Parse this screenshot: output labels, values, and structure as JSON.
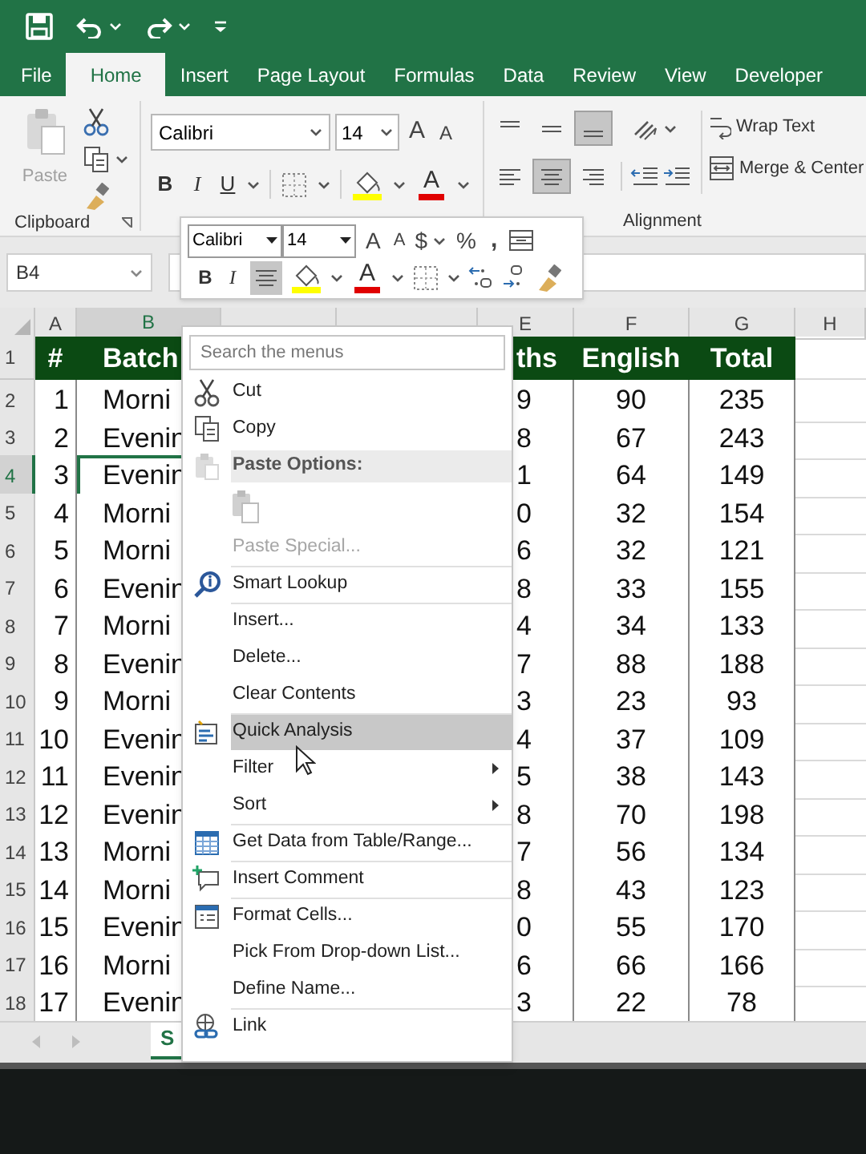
{
  "tabs": [
    {
      "label": "File",
      "selected": false
    },
    {
      "label": "Home",
      "selected": true
    },
    {
      "label": "Insert",
      "selected": false
    },
    {
      "label": "Page Layout",
      "selected": false
    },
    {
      "label": "Formulas",
      "selected": false
    },
    {
      "label": "Data",
      "selected": false
    },
    {
      "label": "Review",
      "selected": false
    },
    {
      "label": "View",
      "selected": false
    },
    {
      "label": "Developer",
      "selected": false
    }
  ],
  "ribbon": {
    "paste_label": "Paste",
    "paste_disabled": true,
    "font_name": "Calibri",
    "font_size": "14",
    "grow_font": "A",
    "shrink_font": "A",
    "bold": "B",
    "italic": "I",
    "underline": "U",
    "font_color": "A",
    "vertical_align_buttons": [
      {
        "selected": false
      },
      {
        "selected": false
      },
      {
        "selected": true
      }
    ],
    "horizontal_align_buttons": [
      {
        "selected": false
      },
      {
        "selected": true
      },
      {
        "selected": false
      }
    ],
    "wrap_text": "Wrap Text",
    "merge_center": "Merge & Center",
    "group_labels": [
      "Clipboard",
      "Alignment"
    ]
  },
  "mini_toolbar": {
    "font_name": "Calibri",
    "font_size": "14",
    "grow_font": "A",
    "shrink_font": "A",
    "currency": "$",
    "percent": "%",
    "comma": ",",
    "bold": "B",
    "italic": "I",
    "center_selected": true,
    "font_color": "A"
  },
  "name_box": "B4",
  "sheet": {
    "columns": [
      {
        "label": "A",
        "selected": false
      },
      {
        "label": "B",
        "selected": true
      },
      {
        "selected": false
      },
      {
        "selected": false
      },
      {
        "label": "E",
        "selected": false
      },
      {
        "label": "F",
        "selected": false
      },
      {
        "label": "G",
        "selected": false
      },
      {
        "label": "H",
        "selected": false
      }
    ],
    "rows": [
      {
        "number": "1",
        "kind": "header",
        "selected": false,
        "cells": [
          "#",
          "Batch",
          "",
          "",
          "ths",
          "English",
          "Total"
        ]
      },
      {
        "number": "2",
        "kind": "data",
        "selected": false,
        "cells": [
          "1",
          "Morni",
          "",
          "",
          "9",
          "90",
          "235"
        ]
      },
      {
        "number": "3",
        "kind": "data",
        "selected": false,
        "cells": [
          "2",
          "Evenin",
          "",
          "",
          "8",
          "67",
          "243"
        ]
      },
      {
        "number": "4",
        "kind": "data",
        "selected": true,
        "cells": [
          "3",
          "Evenin",
          "",
          "",
          "1",
          "64",
          "149"
        ]
      },
      {
        "number": "5",
        "kind": "data",
        "selected": false,
        "cells": [
          "4",
          "Morni",
          "",
          "",
          "0",
          "32",
          "154"
        ]
      },
      {
        "number": "6",
        "kind": "data",
        "selected": false,
        "cells": [
          "5",
          "Morni",
          "",
          "",
          "6",
          "32",
          "121"
        ]
      },
      {
        "number": "7",
        "kind": "data",
        "selected": false,
        "cells": [
          "6",
          "Evenin",
          "",
          "",
          "8",
          "33",
          "155"
        ]
      },
      {
        "number": "8",
        "kind": "data",
        "selected": false,
        "cells": [
          "7",
          "Morni",
          "",
          "",
          "4",
          "34",
          "133"
        ]
      },
      {
        "number": "9",
        "kind": "data",
        "selected": false,
        "cells": [
          "8",
          "Evenin",
          "",
          "",
          "7",
          "88",
          "188"
        ]
      },
      {
        "number": "10",
        "kind": "data",
        "selected": false,
        "cells": [
          "9",
          "Morni",
          "",
          "",
          "3",
          "23",
          "93"
        ]
      },
      {
        "number": "11",
        "kind": "data",
        "selected": false,
        "cells": [
          "10",
          "Evenin",
          "",
          "",
          "4",
          "37",
          "109"
        ]
      },
      {
        "number": "12",
        "kind": "data",
        "selected": false,
        "cells": [
          "11",
          "Evenin",
          "",
          "",
          "5",
          "38",
          "143"
        ]
      },
      {
        "number": "13",
        "kind": "data",
        "selected": false,
        "cells": [
          "12",
          "Evenin",
          "",
          "",
          "8",
          "70",
          "198"
        ]
      },
      {
        "number": "14",
        "kind": "data",
        "selected": false,
        "cells": [
          "13",
          "Morni",
          "",
          "",
          "7",
          "56",
          "134"
        ]
      },
      {
        "number": "15",
        "kind": "data",
        "selected": false,
        "cells": [
          "14",
          "Morni",
          "",
          "",
          "8",
          "43",
          "123"
        ]
      },
      {
        "number": "16",
        "kind": "data",
        "selected": false,
        "cells": [
          "15",
          "Evenin",
          "",
          "",
          "0",
          "55",
          "170"
        ]
      },
      {
        "number": "17",
        "kind": "data",
        "selected": false,
        "cells": [
          "16",
          "Morni",
          "",
          "",
          "6",
          "66",
          "166"
        ]
      },
      {
        "number": "18",
        "kind": "data",
        "selected": false,
        "cells": [
          "17",
          "Evenin",
          "",
          "",
          "3",
          "22",
          "78"
        ]
      }
    ]
  },
  "sheet_tabs": [
    {
      "label": "S",
      "selected": true
    }
  ],
  "context_menu": {
    "search_placeholder": "Search the menus",
    "items": [
      {
        "kind": "item",
        "label": "Cut",
        "disabled": false,
        "highlighted": false,
        "submenu": false,
        "divider_above": false
      },
      {
        "kind": "item",
        "label": "Copy",
        "disabled": false,
        "highlighted": false,
        "submenu": false,
        "divider_above": false
      },
      {
        "kind": "header",
        "label": "Paste Options:",
        "disabled": false,
        "highlighted": false,
        "submenu": false,
        "divider_above": false
      },
      {
        "kind": "paste-icons",
        "disabled": true,
        "highlighted": false,
        "submenu": false,
        "divider_above": false
      },
      {
        "kind": "item",
        "label": "Paste Special...",
        "disabled": true,
        "highlighted": false,
        "submenu": false,
        "divider_above": false
      },
      {
        "kind": "item",
        "label": "Smart Lookup",
        "disabled": false,
        "highlighted": false,
        "submenu": false,
        "divider_above": true
      },
      {
        "kind": "item",
        "label": "Insert...",
        "disabled": false,
        "highlighted": false,
        "submenu": false,
        "divider_above": true
      },
      {
        "kind": "item",
        "label": "Delete...",
        "disabled": false,
        "highlighted": false,
        "submenu": false,
        "divider_above": false
      },
      {
        "kind": "item",
        "label": "Clear Contents",
        "disabled": false,
        "highlighted": false,
        "submenu": false,
        "divider_above": false
      },
      {
        "kind": "item",
        "label": "Quick Analysis",
        "disabled": false,
        "highlighted": true,
        "submenu": false,
        "divider_above": true
      },
      {
        "kind": "item",
        "label": "Filter",
        "disabled": false,
        "highlighted": false,
        "submenu": true,
        "divider_above": false
      },
      {
        "kind": "item",
        "label": "Sort",
        "disabled": false,
        "highlighted": false,
        "submenu": true,
        "divider_above": false
      },
      {
        "kind": "item",
        "label": "Get Data from Table/Range...",
        "disabled": false,
        "highlighted": false,
        "submenu": false,
        "divider_above": true
      },
      {
        "kind": "item",
        "label": "Insert Comment",
        "disabled": false,
        "highlighted": false,
        "submenu": false,
        "divider_above": true
      },
      {
        "kind": "item",
        "label": "Format Cells...",
        "disabled": false,
        "highlighted": false,
        "submenu": false,
        "divider_above": true
      },
      {
        "kind": "item",
        "label": "Pick From Drop-down List...",
        "disabled": false,
        "highlighted": false,
        "submenu": false,
        "divider_above": false
      },
      {
        "kind": "item",
        "label": "Define Name...",
        "disabled": false,
        "highlighted": false,
        "submenu": false,
        "divider_above": false
      },
      {
        "kind": "item",
        "label": "Link",
        "disabled": false,
        "highlighted": false,
        "submenu": false,
        "divider_above": true
      }
    ]
  }
}
